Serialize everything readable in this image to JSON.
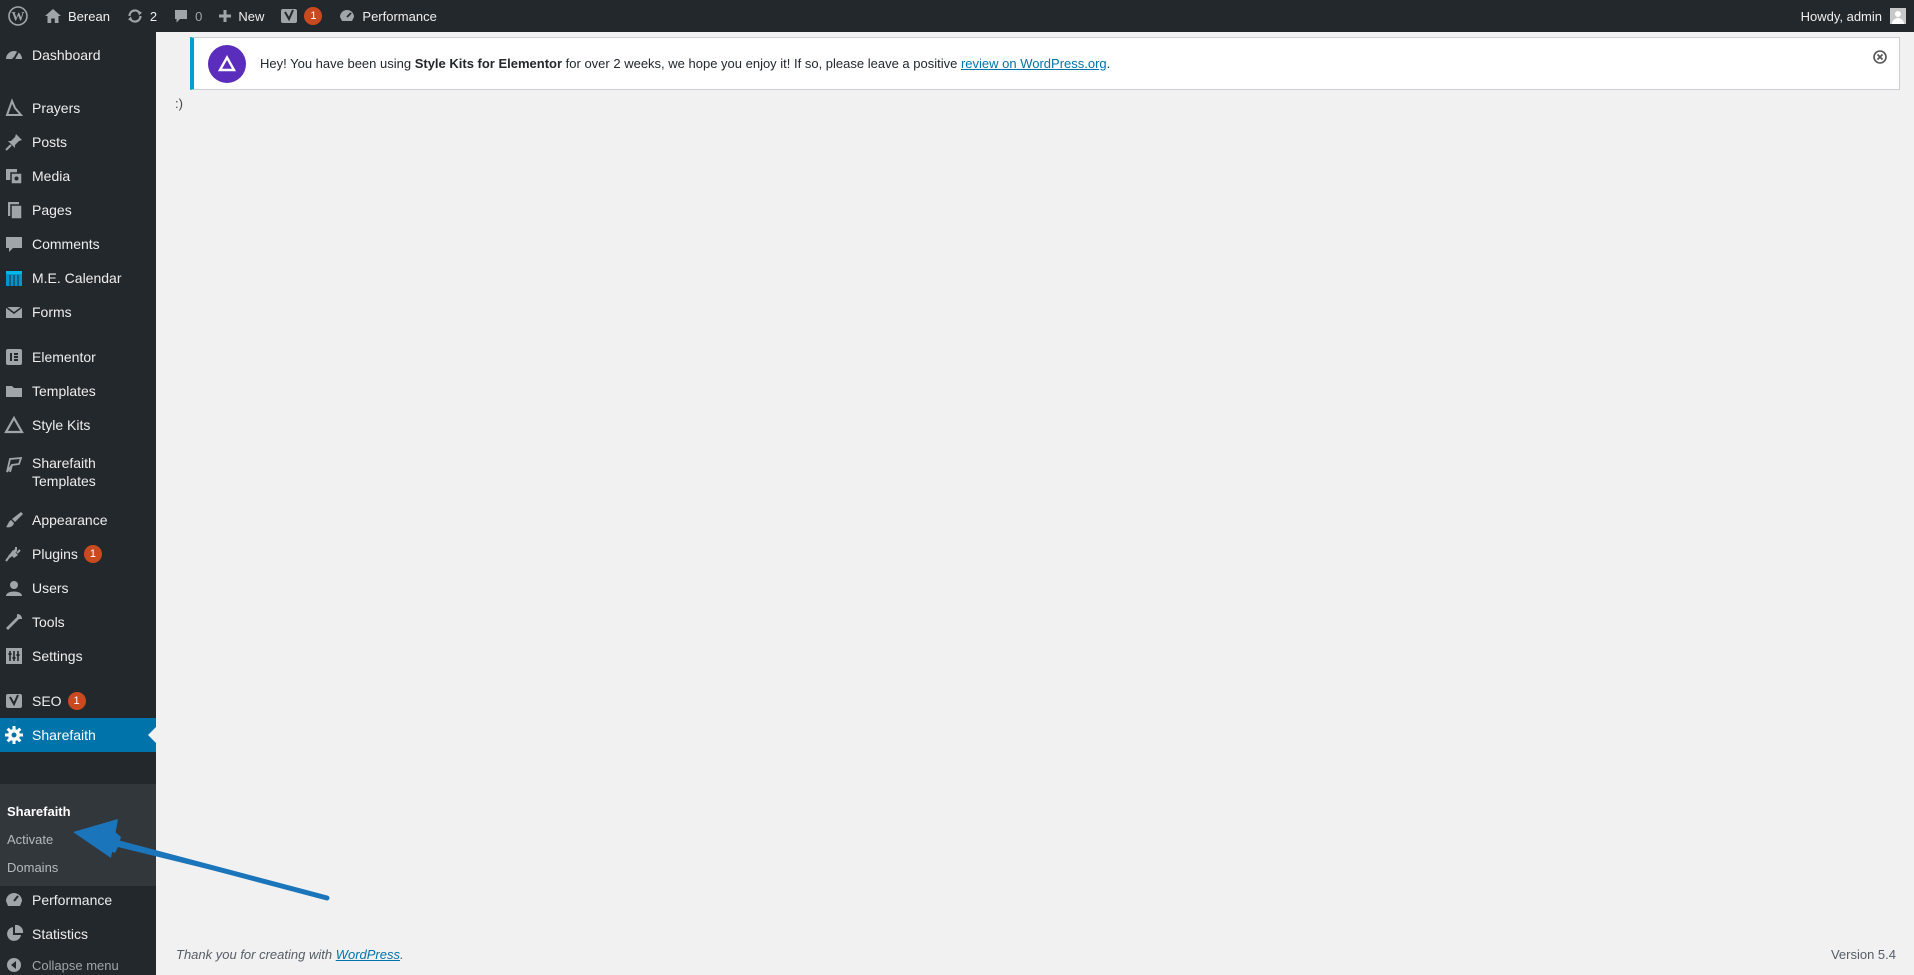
{
  "adminbar": {
    "site_name": "Berean",
    "updates_count": "2",
    "comments_count": "0",
    "new_label": "New",
    "seo_badge": "1",
    "performance_label": "Performance",
    "greeting": "Howdy, admin"
  },
  "sidebar": {
    "items": [
      {
        "label": "Dashboard",
        "icon": "dashboard-icon"
      },
      {
        "label": "Prayers",
        "icon": "prayers-icon"
      },
      {
        "label": "Posts",
        "icon": "pin-icon"
      },
      {
        "label": "Media",
        "icon": "media-icon"
      },
      {
        "label": "Pages",
        "icon": "pages-icon"
      },
      {
        "label": "Comments",
        "icon": "comment-icon"
      },
      {
        "label": "M.E. Calendar",
        "icon": "calendar-icon"
      },
      {
        "label": "Forms",
        "icon": "envelope-icon"
      },
      {
        "label": "Elementor",
        "icon": "elementor-icon"
      },
      {
        "label": "Templates",
        "icon": "folder-icon"
      },
      {
        "label": "Style Kits",
        "icon": "triangle-icon"
      },
      {
        "label": "Sharefaith Templates",
        "icon": "sharefaith-templates-icon"
      },
      {
        "label": "Appearance",
        "icon": "brush-icon"
      },
      {
        "label": "Plugins",
        "icon": "plug-icon",
        "badge": "1"
      },
      {
        "label": "Users",
        "icon": "user-icon"
      },
      {
        "label": "Tools",
        "icon": "wrench-icon"
      },
      {
        "label": "Settings",
        "icon": "settings-icon"
      },
      {
        "label": "SEO",
        "icon": "yoast-icon",
        "badge": "1"
      },
      {
        "label": "Sharefaith",
        "icon": "gear-icon"
      },
      {
        "label": "Performance",
        "icon": "performance-icon"
      },
      {
        "label": "Statistics",
        "icon": "pie-chart-icon"
      }
    ],
    "submenu": [
      "Sharefaith",
      "Activate",
      "Domains"
    ],
    "collapse_label": "Collapse menu"
  },
  "notice": {
    "prefix": "Hey! You have been using ",
    "product": "Style Kits for Elementor",
    "middle": " for over 2 weeks, we hope you enjoy it! If so, please leave a positive ",
    "link_text": "review on WordPress.org",
    "suffix": "."
  },
  "content": {
    "smiley": ":)"
  },
  "footer": {
    "thanks_prefix": "Thank you for creating with ",
    "thanks_link": "WordPress",
    "thanks_suffix": ".",
    "version": "Version 5.4"
  },
  "colors": {
    "adminbar_bg": "#23282d",
    "sidebar_current": "#0073aa",
    "submenu_bg": "#32373c",
    "badge": "#ca4a1f",
    "notice_border": "#00a0d2",
    "notice_logo": "#5a2dbc",
    "annotation_arrow": "#1b75bb"
  }
}
